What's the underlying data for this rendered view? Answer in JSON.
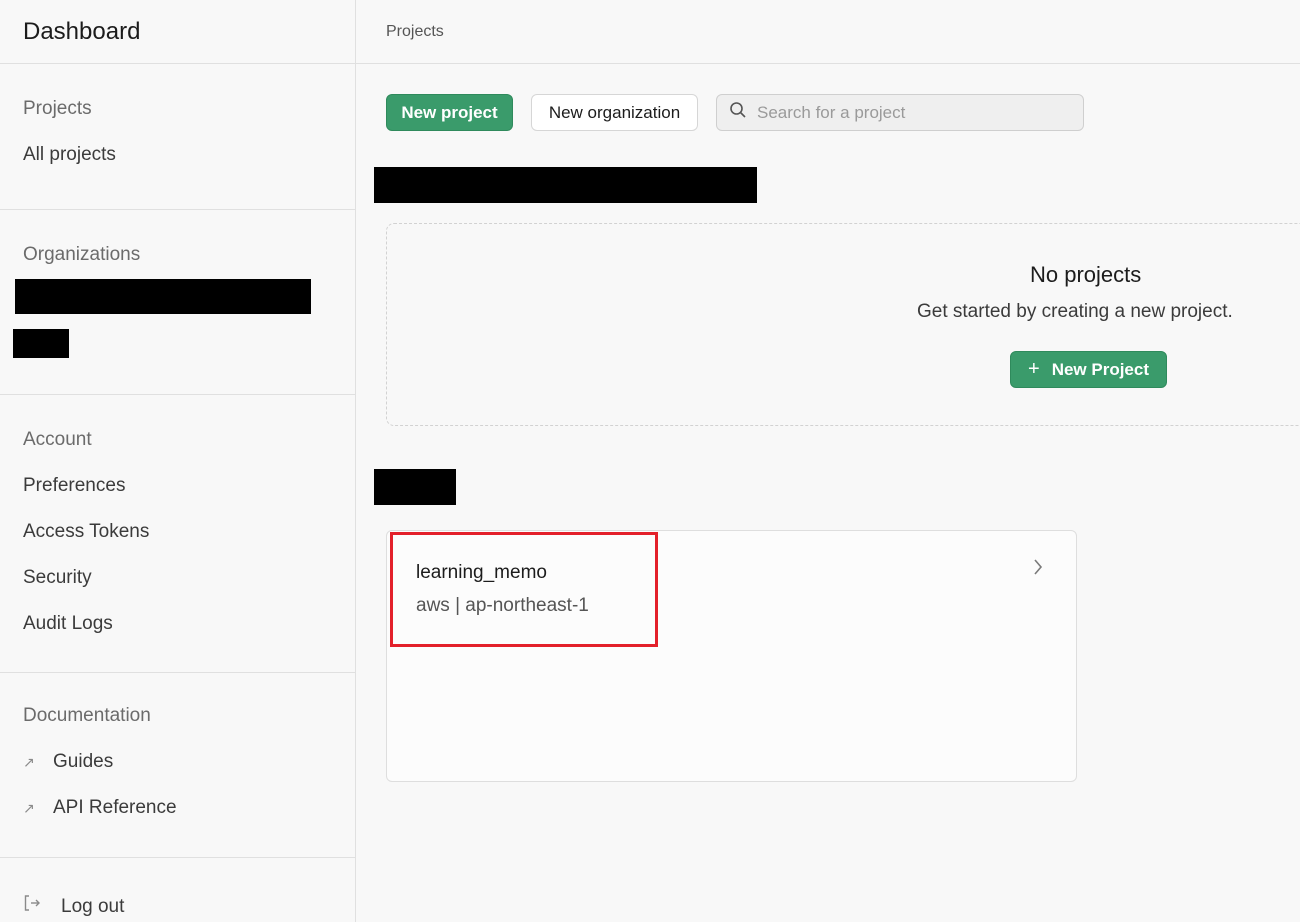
{
  "sidebar": {
    "title": "Dashboard",
    "projects_heading": "Projects",
    "projects_items": [
      {
        "label": "All projects"
      }
    ],
    "organizations_heading": "Organizations",
    "account_heading": "Account",
    "account_items": [
      {
        "label": "Preferences"
      },
      {
        "label": "Access Tokens"
      },
      {
        "label": "Security"
      },
      {
        "label": "Audit Logs"
      }
    ],
    "documentation_heading": "Documentation",
    "documentation_items": [
      {
        "label": "Guides",
        "icon": "external-link-icon"
      },
      {
        "label": "API Reference",
        "icon": "external-link-icon"
      }
    ],
    "logout_label": "Log out",
    "logout_icon": "logout-icon"
  },
  "header": {
    "breadcrumb": "Projects"
  },
  "toolbar": {
    "new_project_label": "New project",
    "new_organization_label": "New organization",
    "search_placeholder": "Search for a project",
    "search_icon": "search-icon"
  },
  "empty_state": {
    "title": "No projects",
    "subtitle": "Get started by creating a new project.",
    "button_label": "New Project",
    "button_icon": "plus-icon"
  },
  "project_card": {
    "name": "learning_memo",
    "region": "aws | ap-northeast-1",
    "icon": "chevron-right-icon"
  },
  "colors": {
    "accent": "#3a9b6b",
    "highlight": "#e3202a",
    "redaction": "#000000"
  }
}
